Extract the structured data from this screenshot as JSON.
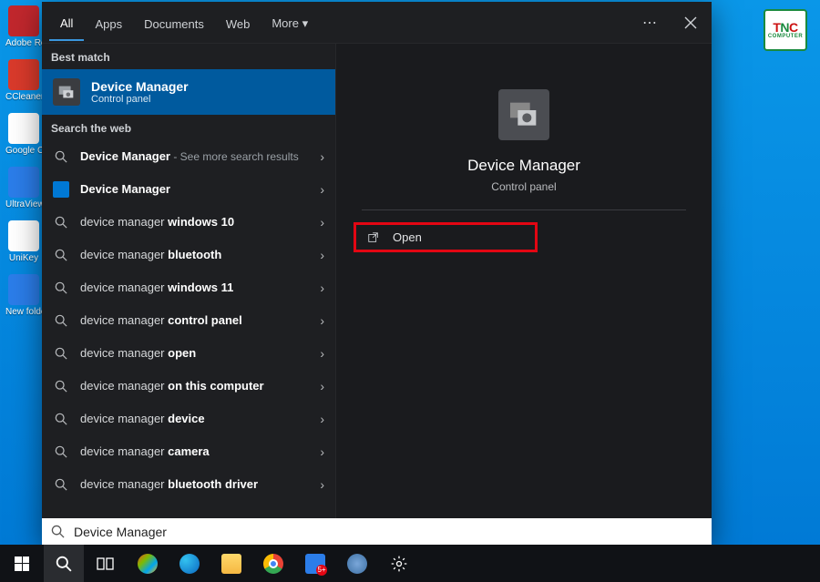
{
  "desktop_icons": [
    {
      "label": "Adobe Reader",
      "bg": "#c1272d"
    },
    {
      "label": "CCleaner",
      "bg": "#d93a2b"
    },
    {
      "label": "Google Chrome",
      "bg": "#ffffff"
    },
    {
      "label": "UltraViewer",
      "bg": "#2b7de9"
    },
    {
      "label": "UniKey",
      "bg": "#ffffff"
    },
    {
      "label": "New folder",
      "bg": "#2b7de9"
    }
  ],
  "tnc": {
    "top_t": "T",
    "top_n": "N",
    "top_c": "C",
    "bottom": "COMPUTER"
  },
  "tabs": [
    {
      "label": "All",
      "active": true
    },
    {
      "label": "Apps",
      "active": false
    },
    {
      "label": "Documents",
      "active": false
    },
    {
      "label": "Web",
      "active": false
    },
    {
      "label": "More ▾",
      "active": false
    }
  ],
  "sections": {
    "best_match": "Best match",
    "search_web": "Search the web"
  },
  "best_match": {
    "title": "Device Manager",
    "subtitle": "Control panel"
  },
  "web_results": [
    {
      "prefix": "",
      "bold": "Device Manager",
      "suffix": "",
      "extra": " - See more search results",
      "icon": "search"
    },
    {
      "prefix": "",
      "bold": "Device Manager",
      "suffix": "",
      "extra": "",
      "icon": "box"
    },
    {
      "prefix": "device manager ",
      "bold": "windows 10",
      "suffix": "",
      "extra": "",
      "icon": "search"
    },
    {
      "prefix": "device manager ",
      "bold": "bluetooth",
      "suffix": "",
      "extra": "",
      "icon": "search"
    },
    {
      "prefix": "device manager ",
      "bold": "windows 11",
      "suffix": "",
      "extra": "",
      "icon": "search"
    },
    {
      "prefix": "device manager ",
      "bold": "control panel",
      "suffix": "",
      "extra": "",
      "icon": "search"
    },
    {
      "prefix": "device manager ",
      "bold": "open",
      "suffix": "",
      "extra": "",
      "icon": "search"
    },
    {
      "prefix": "device manager ",
      "bold": "on this computer",
      "suffix": "",
      "extra": "",
      "icon": "search"
    },
    {
      "prefix": "device manager ",
      "bold": "device",
      "suffix": "",
      "extra": "",
      "icon": "search"
    },
    {
      "prefix": "device manager ",
      "bold": "camera",
      "suffix": "",
      "extra": "",
      "icon": "search"
    },
    {
      "prefix": "device manager ",
      "bold": "bluetooth driver",
      "suffix": "",
      "extra": "",
      "icon": "search"
    }
  ],
  "detail": {
    "title": "Device Manager",
    "subtitle": "Control panel",
    "open": "Open"
  },
  "search": {
    "value": "Device Manager"
  },
  "taskbar": [
    {
      "name": "start"
    },
    {
      "name": "search"
    },
    {
      "name": "task-view"
    },
    {
      "name": "copilot"
    },
    {
      "name": "edge"
    },
    {
      "name": "explorer"
    },
    {
      "name": "chrome"
    },
    {
      "name": "app-blue"
    },
    {
      "name": "shield"
    },
    {
      "name": "settings"
    }
  ]
}
